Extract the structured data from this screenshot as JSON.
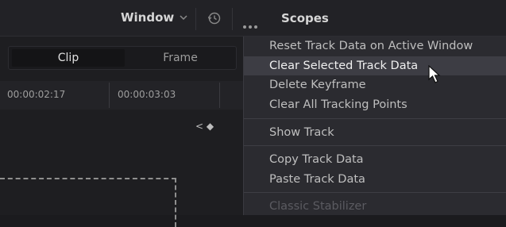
{
  "header": {
    "window_label": "Window",
    "scopes_label": "Scopes"
  },
  "panel": {
    "segments": {
      "clip": "Clip",
      "frame": "Frame"
    },
    "timecodes": [
      "00:00:02:17",
      "00:00:03:03"
    ],
    "keyframe_nav": "< ◆"
  },
  "menu": {
    "items": [
      {
        "label": "Reset Track Data on Active Window",
        "state": "normal"
      },
      {
        "label": "Clear Selected Track Data",
        "state": "highlighted"
      },
      {
        "label": "Delete Keyframe",
        "state": "normal"
      },
      {
        "label": "Clear All Tracking Points",
        "state": "normal"
      },
      {
        "label": "Show Track",
        "state": "normal"
      },
      {
        "label": "Copy Track Data",
        "state": "normal"
      },
      {
        "label": "Paste Track Data",
        "state": "normal"
      },
      {
        "label": "Classic Stabilizer",
        "state": "disabled"
      }
    ]
  },
  "colors": {
    "background": "#1b1b1e",
    "menu_background": "#2b2b30",
    "highlight": "#3d3d44"
  }
}
